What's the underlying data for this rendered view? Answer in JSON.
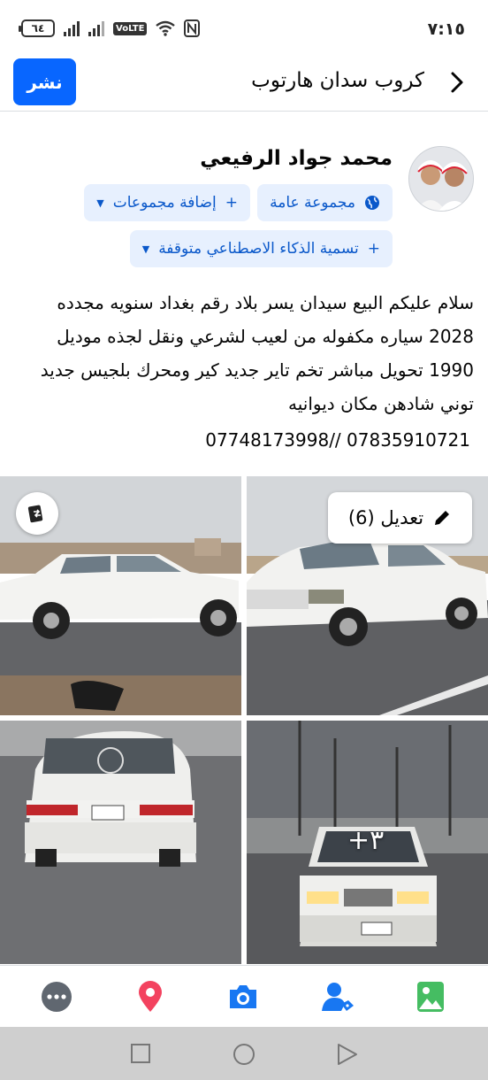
{
  "status_bar": {
    "time": "٧:١٥",
    "battery": "٦٤",
    "network": "VoLTE"
  },
  "header": {
    "title": "كروب سدان هارتوب",
    "post_label": "نشر"
  },
  "author": {
    "name": "محمد جواد الرفيعي"
  },
  "chips": {
    "public_group": "مجموعة عامة",
    "add_groups": "إضافة مجموعات",
    "ai_label": "تسمية الذكاء الاصطناعي متوقفة"
  },
  "post": {
    "text": "سلام عليكم البيع سيدان يسر بلاد رقم بغداد سنويه مجدده 2028 سياره مكفوله من لعيب لشرعي ونقل لجذه موديل 1990 تحويل مباشر تخم تاير جديد كير ومحرك بلجيس جديد توني شادهن مكان ديوانيه",
    "phones": "07748173998// 07835910721"
  },
  "photos": {
    "edit_label": "تعديل (6)",
    "more_count": "+٣"
  },
  "toolbar": {
    "items": [
      "more-icon",
      "location-icon",
      "camera-icon",
      "tag-people-icon",
      "gallery-icon"
    ],
    "colors": {
      "more": "#606770",
      "location": "#f3425f",
      "camera": "#1877f2",
      "tag": "#1877f2",
      "gallery": "#45bd62"
    }
  }
}
